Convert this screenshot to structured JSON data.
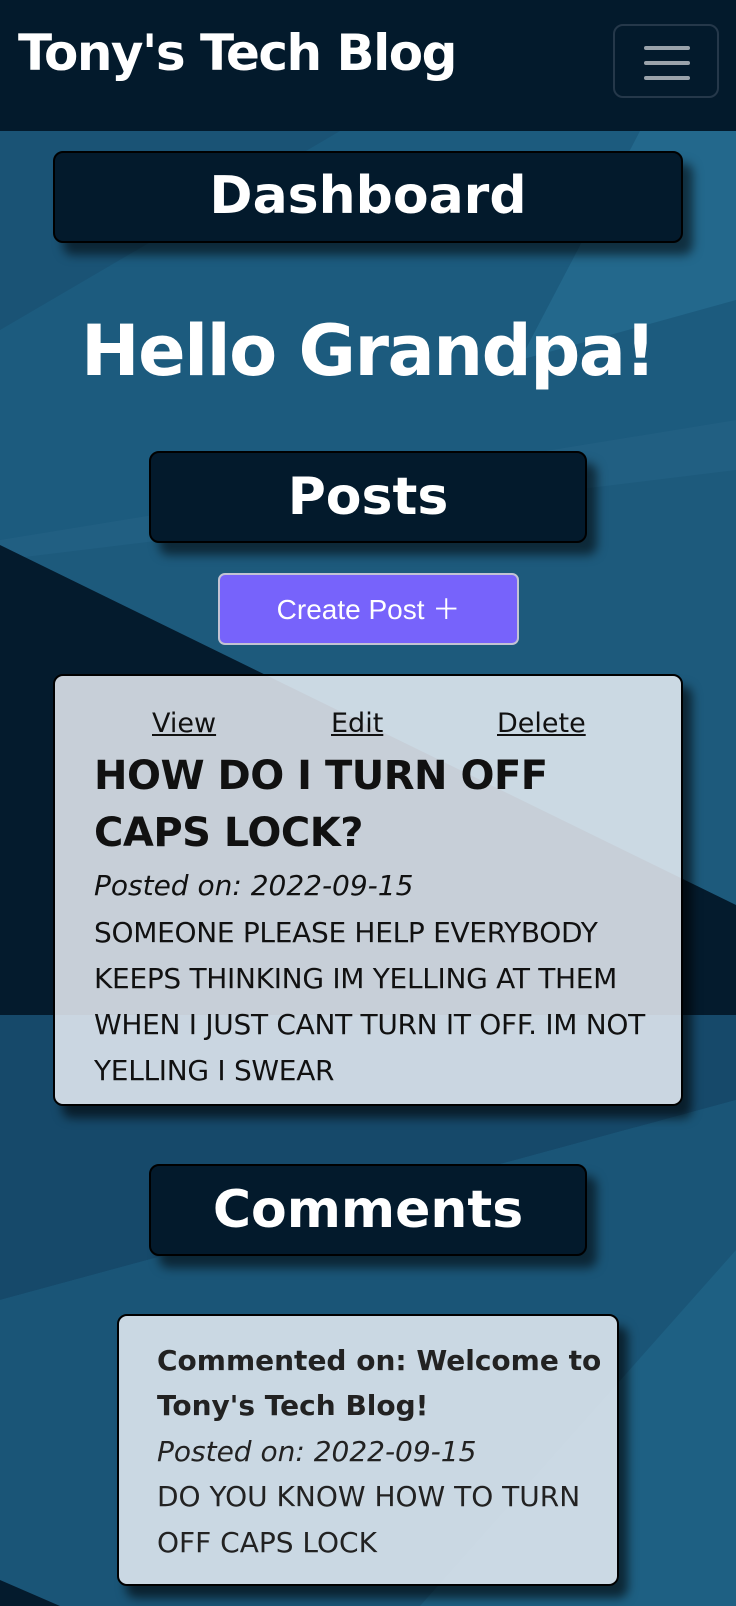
{
  "navbar": {
    "brand": "Tony's Tech Blog",
    "menu_icon": "hamburger-menu-icon"
  },
  "dashboard": {
    "title": "Dashboard"
  },
  "greeting": "Hello Grandpa!",
  "posts": {
    "title": "Posts",
    "create_label": "Create Post ＋",
    "items": [
      {
        "actions": {
          "view": "View",
          "edit": "Edit",
          "delete": "Delete"
        },
        "title": "HOW DO I TURN OFF CAPS LOCK?",
        "date": "Posted on: 2022-09-15",
        "body": "SOMEONE PLEASE HELP EVERYBODY KEEPS THINKING IM YELLING AT THEM WHEN I JUST CANT TURN IT OFF. IM NOT YELLING I SWEAR"
      }
    ]
  },
  "comments": {
    "title": "Comments",
    "items": [
      {
        "title": "Commented on: Welcome to Tony's Tech Blog!",
        "date": "Posted on: 2022-09-15",
        "body": "DO YOU KNOW HOW TO TURN OFF CAPS LOCK"
      }
    ]
  },
  "colors": {
    "navbar_bg": "#031a2c",
    "page_bg": "#1b5577",
    "accent_button": "#7763fb",
    "card_bg": "#e8eef4"
  }
}
